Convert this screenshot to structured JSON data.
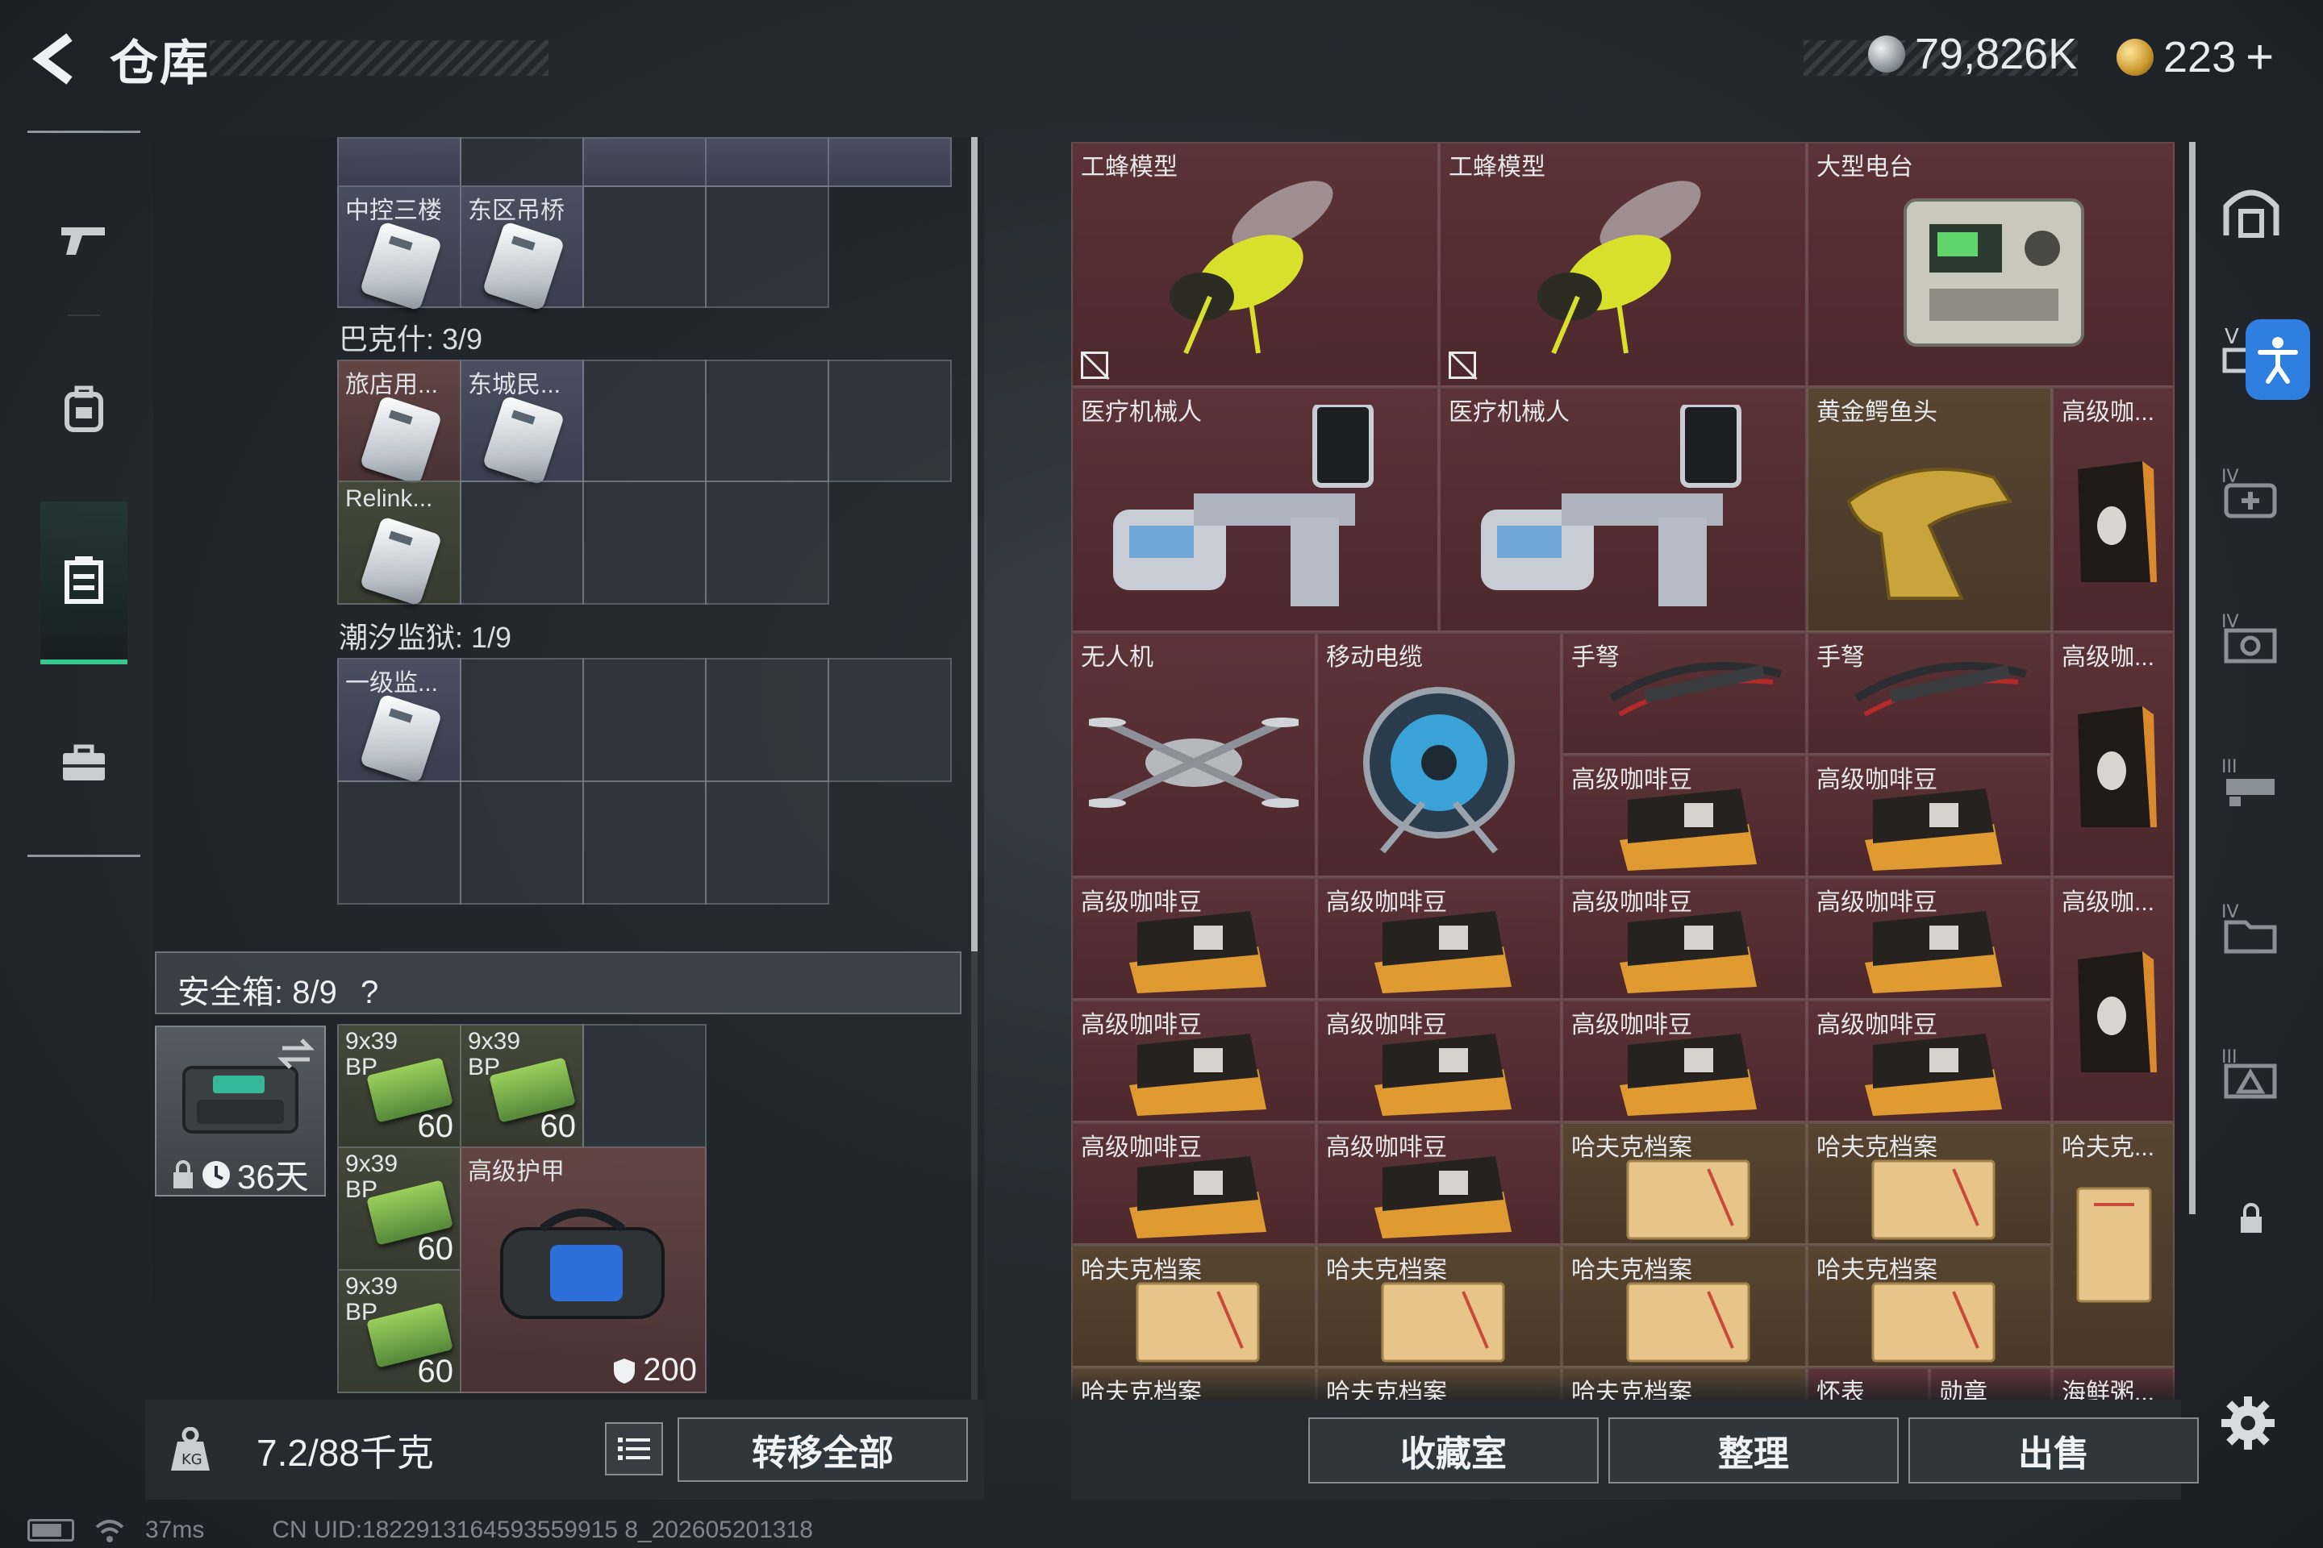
{
  "header": {
    "title": "仓库",
    "currency_silver": "79,826K",
    "currency_gold": "223",
    "plus_label": "+"
  },
  "storage": {
    "top_grid_labels": [
      "中控三楼",
      "东区吊桥"
    ],
    "section_1": "巴克什: 3/9",
    "section_1_labels": [
      "旅店用...",
      "东城民...",
      "Relink..."
    ],
    "section_2": "潮汐监狱: 1/9",
    "section_2_labels": [
      "一级监..."
    ]
  },
  "safe": {
    "header": "安全箱: 8/9",
    "help": "?",
    "days": "36天",
    "ammo": [
      {
        "label1": "9x39",
        "label2": "BP",
        "count": "60"
      },
      {
        "label1": "9x39",
        "label2": "BP",
        "count": "60"
      },
      {
        "label1": "9x39",
        "label2": "BP",
        "count": "60"
      },
      {
        "label1": "9x39",
        "label2": "BP",
        "count": "60"
      }
    ],
    "armor_label": "高级护甲",
    "armor_value": "200"
  },
  "footer_left": {
    "weight": "7.2/88千克",
    "transfer_all": "转移全部"
  },
  "warehouse": {
    "items": [
      {
        "label": "工蜂模型"
      },
      {
        "label": "工蜂模型"
      },
      {
        "label": "大型电台"
      },
      {
        "label": "医疗机械人"
      },
      {
        "label": "医疗机械人"
      },
      {
        "label": "黄金鳄鱼头"
      },
      {
        "label": "高级咖..."
      },
      {
        "label": "无人机"
      },
      {
        "label": "移动电缆"
      },
      {
        "label": "手弩"
      },
      {
        "label": "手弩"
      },
      {
        "label": "高级咖..."
      },
      {
        "label": "高级咖啡豆"
      },
      {
        "label": "高级咖啡豆"
      },
      {
        "label": "高级咖啡豆"
      },
      {
        "label": "高级咖啡豆"
      },
      {
        "label": "高级咖啡豆"
      },
      {
        "label": "高级咖啡豆"
      },
      {
        "label": "高级咖..."
      },
      {
        "label": "高级咖啡豆"
      },
      {
        "label": "高级咖啡豆"
      },
      {
        "label": "高级咖啡豆"
      },
      {
        "label": "高级咖啡豆"
      },
      {
        "label": "高级咖啡豆"
      },
      {
        "label": "高级咖啡豆"
      },
      {
        "label": "哈夫克档案"
      },
      {
        "label": "哈夫克档案"
      },
      {
        "label": "哈夫克..."
      },
      {
        "label": "哈夫克档案"
      },
      {
        "label": "哈夫克档案"
      },
      {
        "label": "哈夫克档案"
      },
      {
        "label": "哈夫克档案"
      },
      {
        "label": "哈夫克档案"
      },
      {
        "label": "哈夫克档案"
      },
      {
        "label": "哈夫克档案"
      },
      {
        "label": "怀表"
      },
      {
        "label": "勋章"
      },
      {
        "label": "海鲜粥..."
      }
    ],
    "buttons": {
      "collection": "收藏室",
      "organize": "整理",
      "sell": "出售"
    }
  },
  "status": {
    "ping": "37ms",
    "uid": "CN UID:1822913164593559915 8_202605201318"
  }
}
